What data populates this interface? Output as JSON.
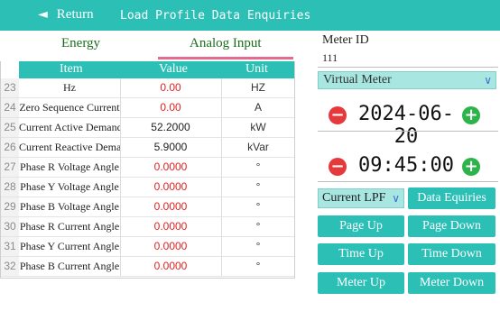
{
  "header": {
    "back_label": "Return",
    "title": "Load Profile Data Enquiries",
    "back_icon": "arrow-left-icon"
  },
  "tabs": [
    {
      "label": "Energy"
    },
    {
      "label": "Analog Input"
    }
  ],
  "table": {
    "columns": [
      "Item",
      "Value",
      "Unit"
    ],
    "rows": [
      {
        "num": "23",
        "item": "Hz",
        "value": "0.00",
        "unit": "HZ",
        "color": "#e02020"
      },
      {
        "num": "24",
        "item": "Zero Sequence Current",
        "value": "0.00",
        "unit": "A",
        "color": "#e02020"
      },
      {
        "num": "25",
        "item": "Current Active Demand",
        "value": "52.2000",
        "unit": "kW",
        "color": "#222222"
      },
      {
        "num": "26",
        "item": "Current Reactive Demand",
        "value": "5.9000",
        "unit": "kVar",
        "color": "#222222"
      },
      {
        "num": "27",
        "item": "Phase R Voltage Angle",
        "value": "0.0000",
        "unit": "°",
        "color": "#e02020"
      },
      {
        "num": "28",
        "item": "Phase Y Voltage Angle",
        "value": "0.0000",
        "unit": "°",
        "color": "#e02020"
      },
      {
        "num": "29",
        "item": "Phase B Voltage Angle",
        "value": "0.0000",
        "unit": "°",
        "color": "#e02020"
      },
      {
        "num": "30",
        "item": "Phase R Current Angle",
        "value": "0.0000",
        "unit": "°",
        "color": "#e02020"
      },
      {
        "num": "31",
        "item": "Phase Y Current Angle",
        "value": "0.0000",
        "unit": "°",
        "color": "#e02020"
      },
      {
        "num": "32",
        "item": "Phase B Current Angle",
        "value": "0.0000",
        "unit": "°",
        "color": "#e02020"
      }
    ]
  },
  "side": {
    "meter_id_label": "Meter ID",
    "meter_id_value": "111",
    "meter_select": "Virtual Meter",
    "date": "2024-06-20",
    "time": "09:45:00",
    "mode_select": "Current LPF",
    "buttons": {
      "data_equiries": "Data Equiries",
      "page_up": "Page Up",
      "page_down": "Page Down",
      "time_up": "Time Up",
      "time_down": "Time Down",
      "meter_up": "Meter Up",
      "meter_down": "Meter Down"
    }
  },
  "colors": {
    "accent": "#2bbfb5",
    "value_red": "#e02020",
    "minus": "#e5393c",
    "plus": "#2cb34a",
    "tab_underline": "#e36b8f"
  }
}
